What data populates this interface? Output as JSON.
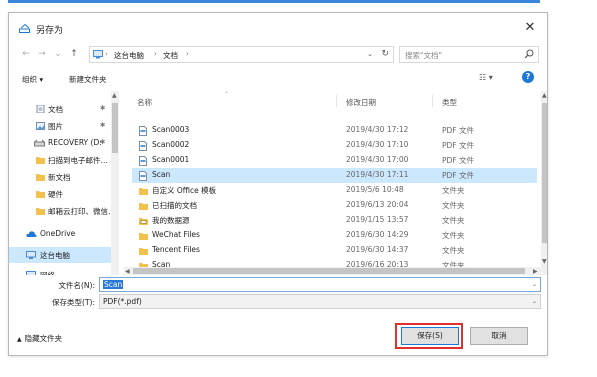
{
  "window": {
    "title": "另存为",
    "close_glyph": "✕"
  },
  "address": {
    "back_glyph": "←",
    "forward_glyph": "→",
    "recent_glyph": "⌄",
    "up_glyph": "↑",
    "segments": [
      "这台电脑",
      "文档"
    ],
    "separator_glyph": "›",
    "dropdown_glyph": "⌄",
    "refresh_glyph": "↻",
    "search_placeholder": "搜索\"文档\""
  },
  "toolbar": {
    "organize_label": "组织 ▾",
    "new_folder_label": "新建文件夹",
    "view_glyph": "☷ ▾",
    "help_glyph": "?"
  },
  "nav_items": [
    {
      "label": "文档",
      "icon": "document-icon",
      "pinned": true
    },
    {
      "label": "图片",
      "icon": "picture-icon",
      "pinned": true
    },
    {
      "label": "RECOVERY (D:",
      "icon": "drive-icon",
      "pinned": true
    },
    {
      "label": "扫描到电子邮件…",
      "icon": "folder-icon",
      "pinned": false
    },
    {
      "label": "新文档",
      "icon": "folder-icon",
      "pinned": false
    },
    {
      "label": "硬件",
      "icon": "folder-icon",
      "pinned": false
    },
    {
      "label": "邮箱云打印、微信…",
      "icon": "folder-icon",
      "pinned": false
    },
    {
      "label": "OneDrive",
      "icon": "cloud-icon",
      "pinned": false
    },
    {
      "label": "这台电脑",
      "icon": "pc-icon",
      "pinned": false
    },
    {
      "label": "网络",
      "icon": "network-icon",
      "pinned": false
    }
  ],
  "nav_pin_glyph": "✱",
  "columns": {
    "name": "名称",
    "date": "修改日期",
    "type": "类型"
  },
  "files": [
    {
      "name": "Scan0003",
      "date": "2019/4/30 17:12",
      "type": "PDF 文件",
      "icon": "pdf-icon"
    },
    {
      "name": "Scan0002",
      "date": "2019/4/30 17:10",
      "type": "PDF 文件",
      "icon": "pdf-icon"
    },
    {
      "name": "Scan0001",
      "date": "2019/4/30 17:00",
      "type": "PDF 文件",
      "icon": "pdf-icon"
    },
    {
      "name": "Scan",
      "date": "2019/4/30 17:11",
      "type": "PDF 文件",
      "icon": "pdf-icon",
      "selected": true
    },
    {
      "name": "自定义 Office 模板",
      "date": "2019/5/6 10:48",
      "type": "文件夹",
      "icon": "folder-icon"
    },
    {
      "name": "已扫描的文档",
      "date": "2019/6/13 20:04",
      "type": "文件夹",
      "icon": "folder-icon"
    },
    {
      "name": "我的数据源",
      "date": "2019/1/15 13:57",
      "type": "文件夹",
      "icon": "datasource-folder-icon"
    },
    {
      "name": "WeChat Files",
      "date": "2019/6/30 14:29",
      "type": "文件夹",
      "icon": "folder-icon"
    },
    {
      "name": "Tencent Files",
      "date": "2019/6/30 14:37",
      "type": "文件夹",
      "icon": "folder-icon"
    },
    {
      "name": "Scan",
      "date": "2019/6/16 20:13",
      "type": "文件夹",
      "icon": "folder-icon"
    }
  ],
  "save_form": {
    "filename_label": "文件名(N):",
    "filename_value": "Scan",
    "filetype_label": "保存类型(T):",
    "filetype_value": "PDF(*.pdf)",
    "dropdown_glyph": "⌄"
  },
  "footer": {
    "hide_folders_caret": "▲",
    "hide_folders_label": "隐藏文件夹",
    "save_label": "保存(S)",
    "cancel_label": "取消"
  },
  "colors": {
    "accent": "#1e78d6",
    "selection": "#cce8ff",
    "folder": "#f2c14e",
    "highlight_box": "#e03030"
  }
}
